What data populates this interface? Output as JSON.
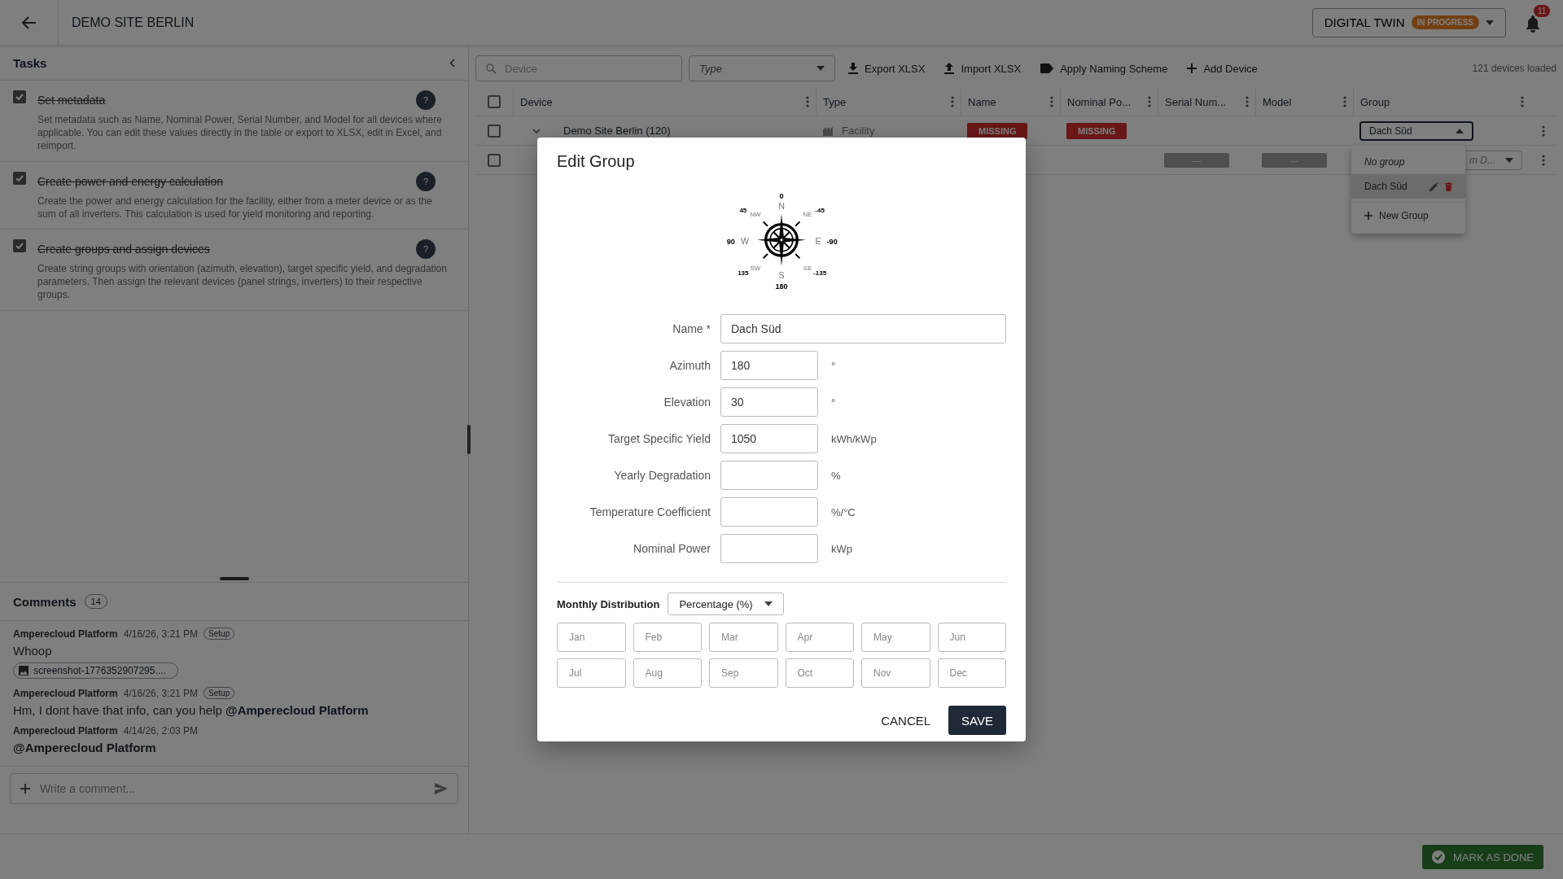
{
  "header": {
    "title": "DEMO SITE BERLIN",
    "twin_button": "DIGITAL TWIN",
    "status_badge": "IN PROGRESS",
    "notification_count": "11"
  },
  "tasks": {
    "title": "Tasks",
    "items": [
      {
        "title": "Set metadata",
        "description": "Set metadata such as Name, Nominal Power, Serial Number, and Model for all devices where applicable. You can edit these values directly in the table or export to XLSX, edit in Excel, and reimport.",
        "checked": true,
        "help": "?"
      },
      {
        "title": "Create power and energy calculation",
        "description": "Create the power and energy calculation for the facility, either from a meter device or as the sum of all inverters. This calculation is used for yield monitoring and reporting.",
        "checked": true,
        "help": "?"
      },
      {
        "title": "Create groups and assign devices",
        "description": "Create string groups with orientation (azimuth, elevation), target specific yield, and degradation parameters. Then assign the relevant devices (panel strings, inverters) to their respective groups.",
        "checked": true,
        "help": "?"
      }
    ]
  },
  "comments": {
    "title": "Comments",
    "count": "14",
    "placeholder": "Write a comment...",
    "items": [
      {
        "author": "Amperecloud Platform",
        "time": "4/16/26, 3:21 PM",
        "tag": "Setup",
        "text": "Whoop",
        "attachment": "screenshot-1776352907295...."
      },
      {
        "author": "Amperecloud Platform",
        "time": "4/16/26, 3:21 PM",
        "tag": "Setup",
        "text": "Hm, I dont have that info, can you help ",
        "mention": "@Amperecloud Platform"
      },
      {
        "author": "Amperecloud Platform",
        "time": "4/14/26, 2:03 PM",
        "mention": "@Amperecloud Platform"
      }
    ]
  },
  "toolbar": {
    "search_placeholder": "Device",
    "type_placeholder": "Type",
    "status": "121 devices loaded",
    "actions": [
      {
        "label": "Export XLSX",
        "kind": "download"
      },
      {
        "label": "Import XLSX",
        "kind": "upload"
      },
      {
        "label": "Apply Naming Scheme",
        "kind": "tag"
      },
      {
        "label": "Add Device",
        "kind": "add"
      }
    ]
  },
  "table": {
    "all_checked": false,
    "columns": [
      "Device",
      "Type",
      "Name",
      "Nominal Po...",
      "Serial Num...",
      "Model",
      "Group"
    ],
    "rows": [
      {
        "checked": false,
        "expanded": true,
        "device": "Demo Site Berlin (120)",
        "type": "Facility",
        "name": {
          "text": "MISSING",
          "kind": "missing"
        },
        "nominal_power": {
          "text": "MISSING",
          "kind": "missing"
        },
        "group": {
          "value": "Dach Süd",
          "expanded": true
        }
      },
      {
        "checked": false,
        "serial": {
          "text": "—",
          "kind": "placeholder"
        },
        "model": {
          "text": "—",
          "kind": "placeholder"
        },
        "group": {
          "hint": "m D...",
          "expanded": false
        }
      }
    ]
  },
  "group_menu": {
    "items": [
      {
        "label": "No group",
        "kind": "none",
        "selected": false
      },
      {
        "label": "Dach Süd",
        "kind": "group",
        "selected": true
      },
      {
        "label": "New Group",
        "kind": "add"
      }
    ]
  },
  "dialog": {
    "title": "Edit Group",
    "compass": [
      {
        "kind": "n",
        "letter": "N",
        "degrees": "0"
      },
      {
        "kind": "nw",
        "letter": "NW",
        "degrees": "45"
      },
      {
        "kind": "ne",
        "letter": "NE",
        "degrees": "-45"
      },
      {
        "kind": "w",
        "letter": "W",
        "degrees": "90"
      },
      {
        "kind": "e",
        "letter": "E",
        "degrees": "-90"
      },
      {
        "kind": "sw",
        "letter": "SW",
        "degrees": "135"
      },
      {
        "kind": "se",
        "letter": "SE",
        "degrees": "-135"
      },
      {
        "kind": "s",
        "letter": "S",
        "degrees": "180"
      }
    ],
    "fields": [
      {
        "label": "Name *",
        "value": "Dach Süd",
        "kind": "wide"
      },
      {
        "label": "Azimuth",
        "value": "180",
        "unit": "°",
        "kind": "short"
      },
      {
        "label": "Elevation",
        "value": "30",
        "unit": "°",
        "kind": "short"
      },
      {
        "label": "Target Specific Yield",
        "value": "1050",
        "unit": "kWh/kWp",
        "kind": "short"
      },
      {
        "label": "Yearly Degradation",
        "unit": "%",
        "kind": "short"
      },
      {
        "label": "Temperature Coefficient",
        "unit": "%/°C",
        "kind": "short"
      },
      {
        "label": "Nominal Power",
        "unit": "kWp",
        "kind": "short"
      }
    ],
    "distribution_label": "Monthly Distribution",
    "distribution_mode": "Percentage (%)",
    "months": [
      {
        "placeholder": "Jan"
      },
      {
        "placeholder": "Feb"
      },
      {
        "placeholder": "Mar"
      },
      {
        "placeholder": "Apr"
      },
      {
        "placeholder": "May"
      },
      {
        "placeholder": "Jun"
      },
      {
        "placeholder": "Jul"
      },
      {
        "placeholder": "Aug"
      },
      {
        "placeholder": "Sep"
      },
      {
        "placeholder": "Oct"
      },
      {
        "placeholder": "Nov"
      },
      {
        "placeholder": "Dec"
      }
    ],
    "cancel": "CANCEL",
    "save": "SAVE"
  },
  "footer": {
    "button": "MARK AS DONE"
  }
}
